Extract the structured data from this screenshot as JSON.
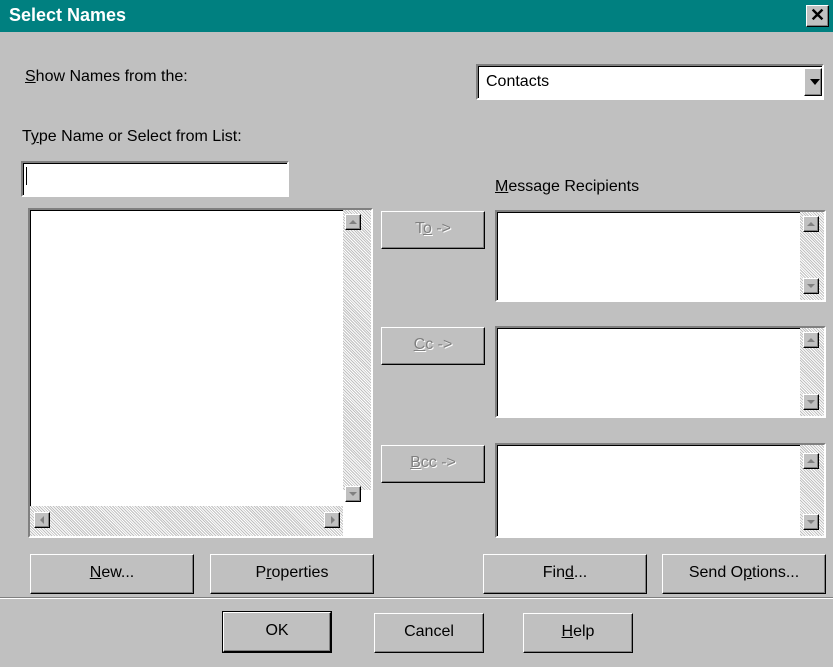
{
  "window": {
    "title": "Select Names",
    "close_glyph": "✕"
  },
  "show_names": {
    "label_prefix_u": "S",
    "label_rest": "how Names from the:",
    "selected": "Contacts"
  },
  "type_name": {
    "label_prefix": "T",
    "label_u": "y",
    "label_rest": "pe Name or Select from List:",
    "value": ""
  },
  "recipients": {
    "label_u": "M",
    "label_rest": "essage Recipients"
  },
  "transfer_buttons": {
    "to": {
      "u": "T",
      "mid": "o",
      "rest": " ->",
      "full": "To ->"
    },
    "cc": {
      "u": "C",
      "rest": "c ->"
    },
    "bcc": {
      "u": "B",
      "rest": "cc ->"
    }
  },
  "buttons": {
    "new": {
      "u": "N",
      "rest": "ew..."
    },
    "properties": {
      "pre": "P",
      "u": "r",
      "rest": "operties"
    },
    "find": {
      "pre": "Fin",
      "u": "d",
      "rest": "..."
    },
    "send_options": {
      "pre": "Send O",
      "u": "p",
      "rest": "tions..."
    },
    "ok": "OK",
    "cancel": "Cancel",
    "help": {
      "u": "H",
      "rest": "elp"
    }
  },
  "icons": {
    "close": "close-icon",
    "dropdown": "chevron-down-icon"
  }
}
